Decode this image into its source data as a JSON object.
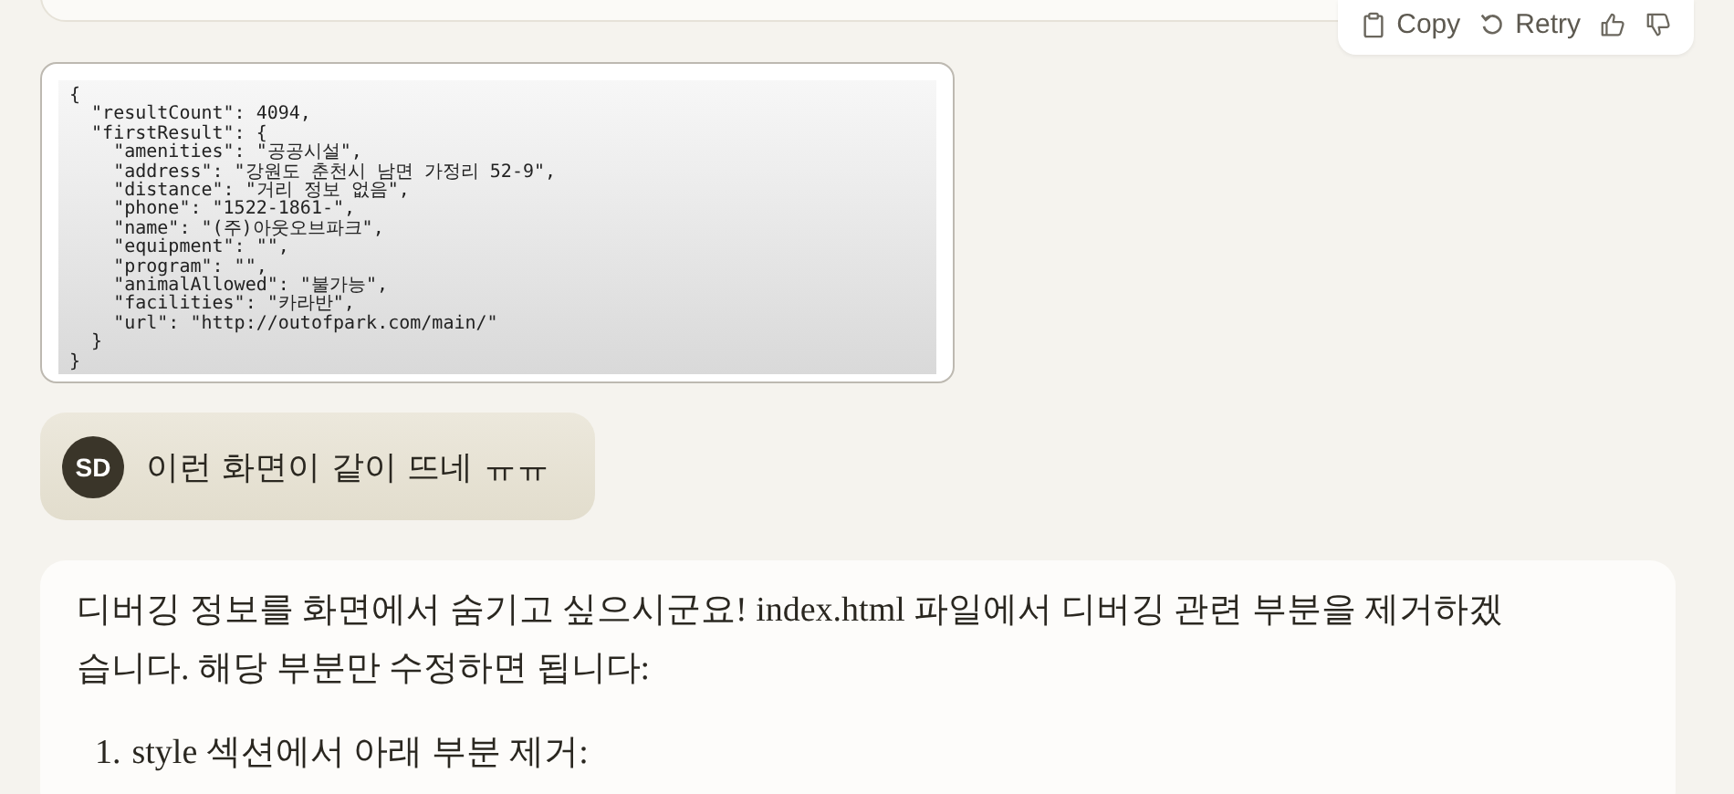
{
  "assistant_actions": {
    "buttons": [
      {
        "kind": "copy",
        "label": "Copy"
      },
      {
        "kind": "retry",
        "label": "Retry"
      },
      {
        "kind": "thumbs_up"
      },
      {
        "kind": "thumbs_down"
      }
    ]
  },
  "attachment": {
    "code_lines": [
      "{",
      "  \"resultCount\": 4094,",
      "  \"firstResult\": {",
      "    \"amenities\": \"공공시설\",",
      "    \"address\": \"강원도 춘천시 남면 가정리 52-9\",",
      "    \"distance\": \"거리 정보 없음\",",
      "    \"phone\": \"1522-1861-\",",
      "    \"name\": \"(주)아웃오브파크\",",
      "    \"equipment\": \"\",",
      "    \"program\": \"\",",
      "    \"animalAllowed\": \"불가능\",",
      "    \"facilities\": \"카라반\",",
      "    \"url\": \"http://outofpark.com/main/\"",
      "  }",
      "}"
    ]
  },
  "user_message": {
    "avatar": "SD",
    "text": "이런 화면이 같이 뜨네 ㅠㅠ"
  },
  "assistant_message": {
    "paragraph": "디버깅 정보를 화면에서 숨기고 싶으시군요! index.html 파일에서 디버깅 관련 부분을 제거하겠습니다. 해당 부분만 수정하면 됩니다:",
    "list": [
      {
        "number": "1.",
        "text": "style 섹션에서 아래 부분 제거:"
      }
    ]
  }
}
